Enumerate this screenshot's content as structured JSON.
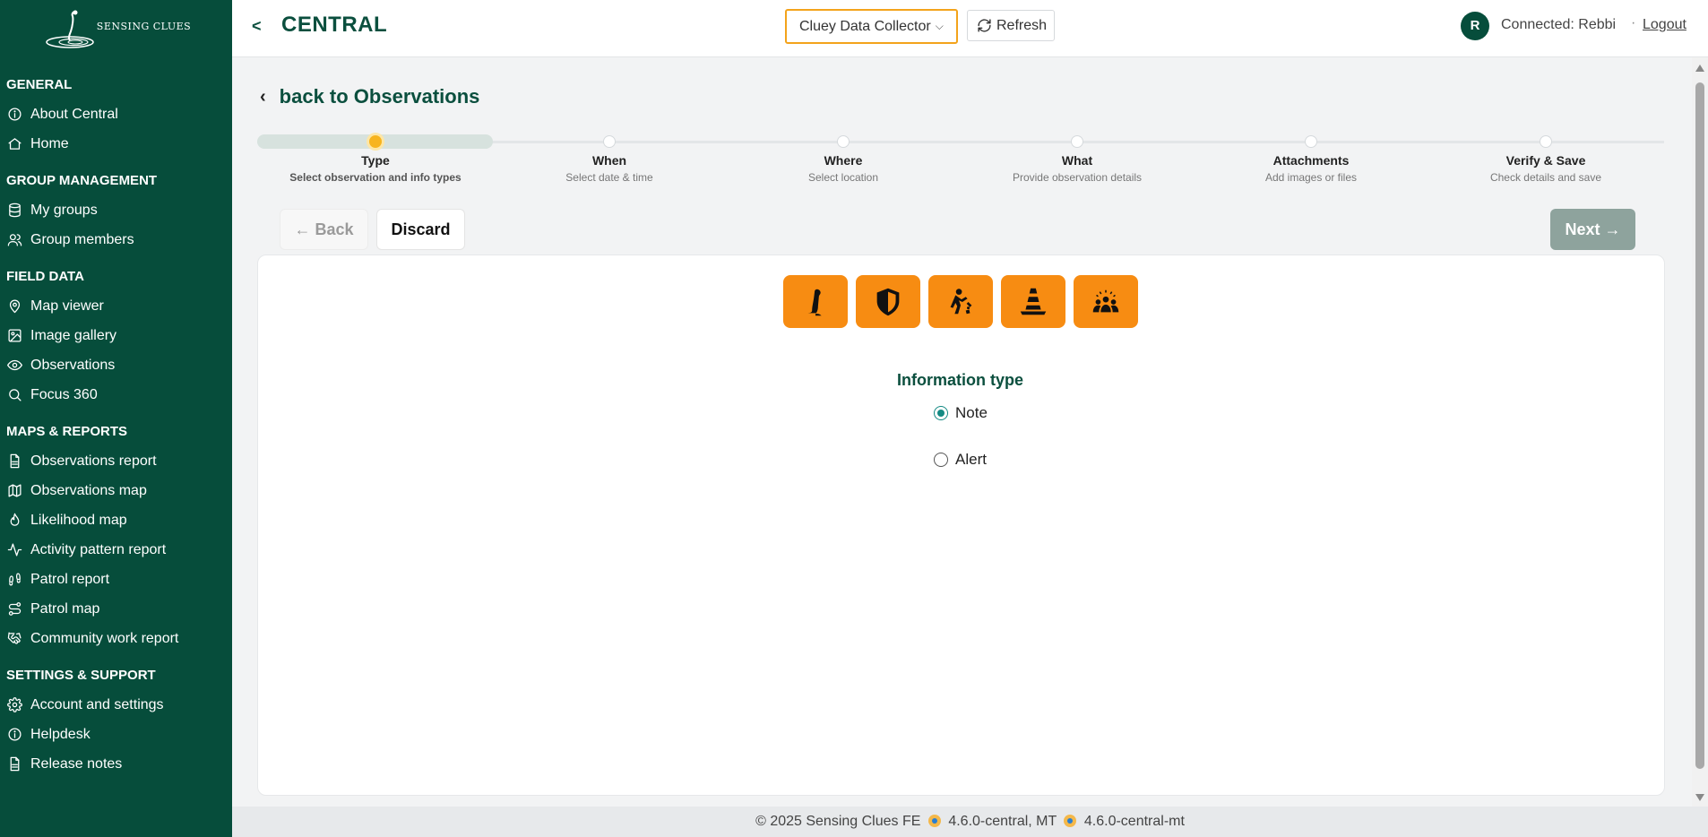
{
  "app": {
    "logo_text": "SENSING CLUES",
    "back_chevron": "<",
    "title": "CENTRAL"
  },
  "header": {
    "collector_label": "Cluey Data Collector",
    "refresh_label": "Refresh",
    "avatar_initial": "R",
    "connected_text": "Connected: Rebbi",
    "separator": "·",
    "logout_label": "Logout"
  },
  "sidebar": {
    "sections": [
      {
        "title": "GENERAL",
        "items": [
          {
            "label": "About Central",
            "icon": "info-icon"
          },
          {
            "label": "Home",
            "icon": "home-icon"
          }
        ]
      },
      {
        "title": "GROUP MANAGEMENT",
        "items": [
          {
            "label": "My groups",
            "icon": "database-icon"
          },
          {
            "label": "Group members",
            "icon": "users-icon"
          }
        ]
      },
      {
        "title": "FIELD DATA",
        "items": [
          {
            "label": "Map viewer",
            "icon": "map-pin-icon"
          },
          {
            "label": "Image gallery",
            "icon": "image-icon"
          },
          {
            "label": "Observations",
            "icon": "eye-icon"
          },
          {
            "label": "Focus 360",
            "icon": "search-icon"
          }
        ]
      },
      {
        "title": "MAPS & REPORTS",
        "items": [
          {
            "label": "Observations report",
            "icon": "file-icon"
          },
          {
            "label": "Observations map",
            "icon": "map-icon"
          },
          {
            "label": "Likelihood map",
            "icon": "flame-icon"
          },
          {
            "label": "Activity pattern report",
            "icon": "activity-icon"
          },
          {
            "label": "Patrol report",
            "icon": "footprints-icon"
          },
          {
            "label": "Patrol map",
            "icon": "route-icon"
          },
          {
            "label": "Community work report",
            "icon": "handshake-icon"
          }
        ]
      },
      {
        "title": "SETTINGS & SUPPORT",
        "items": [
          {
            "label": "Account and settings",
            "icon": "gear-icon"
          },
          {
            "label": "Helpdesk",
            "icon": "info-icon"
          },
          {
            "label": "Release notes",
            "icon": "file-icon"
          }
        ]
      }
    ]
  },
  "page": {
    "back_link": "back to Observations",
    "back_arrow": "‹"
  },
  "stepper": {
    "steps": [
      {
        "label": "Type",
        "sub": "Select observation and info types"
      },
      {
        "label": "When",
        "sub": "Select date & time"
      },
      {
        "label": "Where",
        "sub": "Select location"
      },
      {
        "label": "What",
        "sub": "Provide observation details"
      },
      {
        "label": "Attachments",
        "sub": "Add images or files"
      },
      {
        "label": "Verify & Save",
        "sub": "Check details and save"
      }
    ],
    "active_index": 0
  },
  "actions": {
    "back_label": "← Back",
    "discard_label": "Discard",
    "next_label": "Next →"
  },
  "observation_types": [
    {
      "icon": "animal-icon"
    },
    {
      "icon": "shield-icon"
    },
    {
      "icon": "poacher-icon"
    },
    {
      "icon": "traffic-cone-icon"
    },
    {
      "icon": "community-icon"
    }
  ],
  "info_type": {
    "title": "Information type",
    "options": [
      {
        "label": "Note",
        "checked": true
      },
      {
        "label": "Alert",
        "checked": false
      }
    ]
  },
  "footer": {
    "copyright": "© 2025 Sensing Clues  FE",
    "fe_version": "4.6.0-central, MT",
    "mt_version": "4.6.0-central-mt"
  },
  "colors": {
    "sidebar_bg": "#064d3b",
    "accent_orange": "#f78c12",
    "collector_border": "#f3a31b",
    "step_active": "#f7b41e",
    "radio_checked": "#148a83"
  }
}
